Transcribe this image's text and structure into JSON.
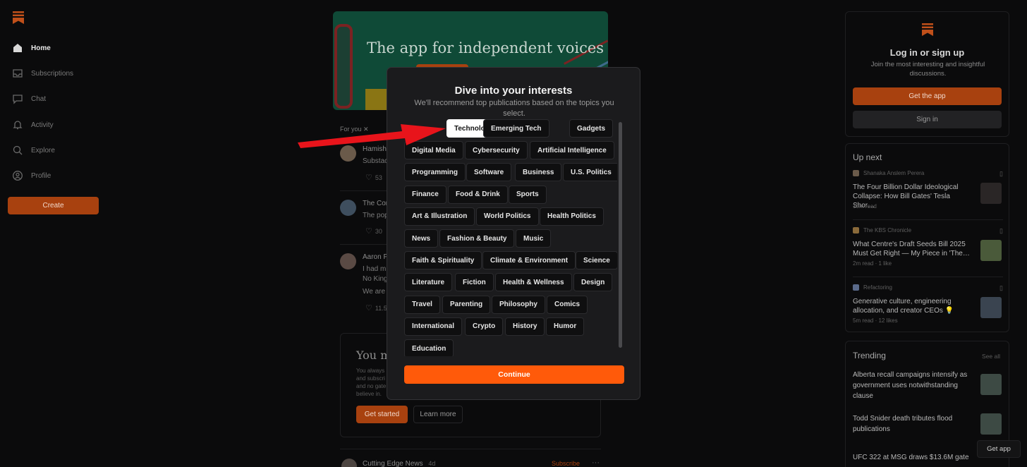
{
  "sidebar": {
    "items": [
      {
        "label": "Home",
        "icon": "home-icon"
      },
      {
        "label": "Subscriptions",
        "icon": "inbox-icon"
      },
      {
        "label": "Chat",
        "icon": "chat-icon"
      },
      {
        "label": "Activity",
        "icon": "bell-icon"
      },
      {
        "label": "Explore",
        "icon": "search-icon"
      },
      {
        "label": "Profile",
        "icon": "profile-icon"
      }
    ],
    "create_label": "Create"
  },
  "feed": {
    "banner_title": "The app for independent voices",
    "for_you": "For you",
    "posts": [
      {
        "author": "Hamish",
        "line1": "Substac",
        "stat": "53"
      },
      {
        "author": "The Cor",
        "line1": "The pop",
        "stat": "30"
      },
      {
        "author": "Aaron P",
        "line1": "I had m",
        "line2": "No King",
        "line3": "We are i",
        "stat": "11.5"
      }
    ],
    "promo": {
      "title": "You m",
      "lines": [
        "You always",
        "and subscri",
        "and no gate",
        "believe in."
      ],
      "get_started": "Get started",
      "learn_more": "Learn more"
    },
    "bottom_post": {
      "author": "Cutting Edge News",
      "time": "4d",
      "subscribe": "Subscribe"
    }
  },
  "right_rail": {
    "login": {
      "title": "Log in or sign up",
      "subtitle": "Join the most interesting and insightful discussions.",
      "get_app": "Get the app",
      "sign_in": "Sign in"
    },
    "up_next": {
      "heading": "Up next",
      "items": [
        {
          "pub": "Shanaka Anslem Perera",
          "title": "The Four Billion Dollar Ideological Collapse: How Bill Gates' Tesla Shor…",
          "meta": "10m read"
        },
        {
          "pub": "The KBS Chronicle",
          "title": "What Centre's Draft Seeds Bill 2025 Must Get Right — My Piece in 'The…",
          "meta": "2m read · 1 like"
        },
        {
          "pub": "Refactoring",
          "title": "Generative culture, engineering allocation, and creator CEOs 💡",
          "meta": "5m read · 12 likes"
        }
      ]
    },
    "trending": {
      "heading": "Trending",
      "see_all": "See all",
      "items": [
        {
          "title": "Alberta recall campaigns intensify as government uses notwithstanding clause"
        },
        {
          "title": "Todd Snider death tributes flood publications"
        },
        {
          "title": "UFC 322 at MSG draws $13.6M gate"
        }
      ]
    },
    "get_app_float": "Get app"
  },
  "modal": {
    "title": "Dive into your interests",
    "subtitle": "We'll recommend top publications based on the topics you select.",
    "selected": "Technology",
    "topics": [
      "Technology",
      "Emerging Tech",
      "Gadgets",
      "Digital Media",
      "Cybersecurity",
      "Artificial Intelligence",
      "Programming",
      "Software",
      "Business",
      "U.S. Politics",
      "Finance",
      "Food & Drink",
      "Sports",
      "Art & Illustration",
      "World Politics",
      "Health Politics",
      "News",
      "Fashion & Beauty",
      "Music",
      "Faith & Spirituality",
      "Climate & Environment",
      "Science",
      "Literature",
      "Fiction",
      "Health & Wellness",
      "Design",
      "Travel",
      "Parenting",
      "Philosophy",
      "Comics",
      "International",
      "Crypto",
      "History",
      "Humor",
      "Education"
    ],
    "continue_label": "Continue"
  },
  "colors": {
    "accent": "#ff5a0a",
    "accent_dim": "#a8410f",
    "background": "#0b0b0c",
    "modal_bg": "#1b1b1d",
    "annotation_red": "#e8141b"
  }
}
